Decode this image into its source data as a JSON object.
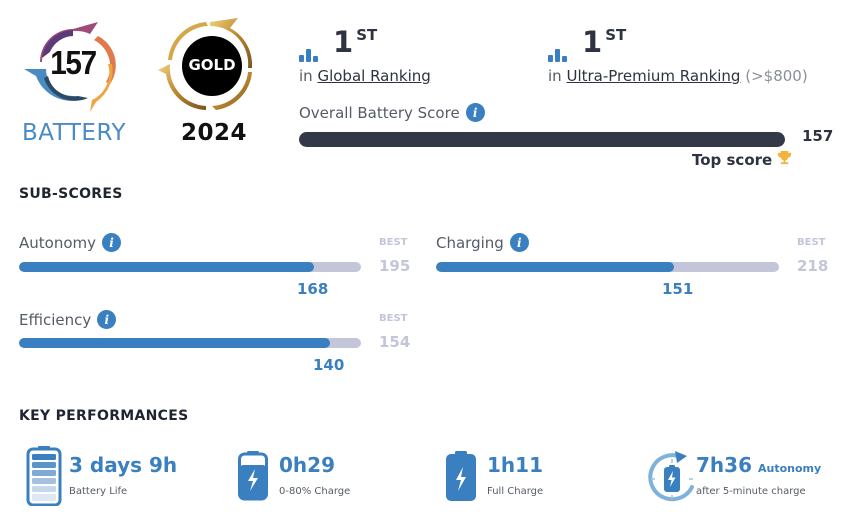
{
  "badges": {
    "battery_score": "157",
    "battery_label": "BATTERY",
    "gold_label": "GOLD",
    "year": "2024"
  },
  "rankings": [
    {
      "rank": "1",
      "suffix": "ST",
      "prefix": "in",
      "link": "Global Ranking",
      "note": ""
    },
    {
      "rank": "1",
      "suffix": "ST",
      "prefix": "in",
      "link": "Ultra-Premium Ranking",
      "note": "(>$800)"
    }
  ],
  "overall": {
    "label": "Overall Battery Score",
    "info_icon": "info-icon",
    "value": "157",
    "fill_fraction": 1.0,
    "top_score_label": "Top score",
    "trophy_icon": "trophy-icon"
  },
  "subscores": {
    "title": "SUB-SCORES",
    "best_label": "BEST",
    "items": [
      {
        "label": "Autonomy",
        "value": "168",
        "best": "195",
        "fill_fraction": 0.862
      },
      {
        "label": "Charging",
        "value": "151",
        "best": "218",
        "fill_fraction": 0.693
      },
      {
        "label": "Efficiency",
        "value": "140",
        "best": "154",
        "fill_fraction": 0.909
      }
    ]
  },
  "key_performances": {
    "title": "KEY PERFORMANCES",
    "items": [
      {
        "icon": "battery-life-icon",
        "value": "3 days 9h",
        "label": "Battery Life",
        "extra": ""
      },
      {
        "icon": "charging-battery-icon",
        "value": "0h29",
        "label": "0-80% Charge",
        "extra": ""
      },
      {
        "icon": "full-charge-icon",
        "value": "1h11",
        "label": "Full Charge",
        "extra": ""
      },
      {
        "icon": "quick-charge-cycle-icon",
        "value": "7h36",
        "label": "after 5-minute charge",
        "extra": "Autonomy"
      }
    ]
  },
  "colors": {
    "accent": "#3a7fbf",
    "dark": "#333946",
    "track": "#c3c6d8",
    "trophy": "#f3b33d"
  }
}
